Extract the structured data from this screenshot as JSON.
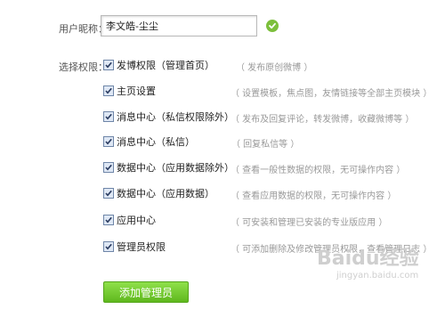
{
  "nickname": {
    "label": "用户昵称：",
    "value": "李文皓-尘尘",
    "status_icon": "check-circle-icon"
  },
  "permissions": {
    "label": "选择权限：",
    "items": [
      {
        "label": "发博权限（管理首页）",
        "desc": "（ 发布原创微博 ）",
        "checked": true
      },
      {
        "label": "主页设置",
        "desc": "（ 设置模板，焦点图，友情链接等全部主页模块 ）",
        "checked": true
      },
      {
        "label": "消息中心（私信权限除外）",
        "desc": "（ 发布及回复评论，转发微博，收藏微博等 ）",
        "checked": true
      },
      {
        "label": "消息中心（私信）",
        "desc": "（ 回复私信等 ）",
        "checked": true
      },
      {
        "label": "数据中心（应用数据除外）",
        "desc": "（ 查看一般性数据的权限，无可操作内容 ）",
        "checked": true
      },
      {
        "label": "数据中心（应用数据）",
        "desc": "（ 查看应用数据的权限，无可操作内容 ）",
        "checked": true
      },
      {
        "label": "应用中心",
        "desc": "（ 可安装和管理已安装的专业版应用 ）",
        "checked": true
      },
      {
        "label": "管理员权限",
        "desc": "（ 可添加删除及修改管理员权限，查看管理日志 ）",
        "checked": true
      }
    ]
  },
  "submit_label": "添加管理员",
  "watermark": {
    "main": "Baidu经验",
    "sub": "jingyan.baidu.com"
  },
  "colors": {
    "button": "#6cc52a",
    "check_ok": "#7cbf3b"
  }
}
